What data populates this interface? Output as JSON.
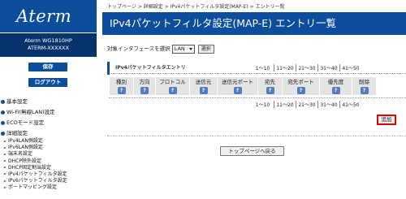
{
  "sidebar": {
    "logo": "Aterm",
    "model": "Aterm WG1810HP",
    "device": "ATERM-XXXXXX",
    "save_label": "保存",
    "logout_label": "ログアウト",
    "menu": [
      {
        "label": "基本設定"
      },
      {
        "label": "Wi-Fi(無線LAN)設定"
      },
      {
        "label": "ECOモード設定"
      },
      {
        "label": "詳細設定"
      }
    ],
    "submenu": [
      "IPv4LAN側設定",
      "IPv6LAN側設定",
      "端末名設定",
      "DHCP除外設定",
      "DHCP固定割当設定",
      "IPv4パケットフィルタ設定",
      "IPv6パケットフィルタ設定",
      "ポートマッピング設定"
    ]
  },
  "breadcrumb": "トップページ > 詳細設定 > IPv4パケットフィルタ設定(MAP-E) > エントリ一覧",
  "page_title": "IPv4パケットフィルタ設定(MAP-E) エントリ一覧",
  "interface": {
    "label": "対象インタフェースを選択",
    "selected": "LAN",
    "select_button": "選択"
  },
  "entry_title": "IPv4パケットフィルタエントリ",
  "pager": [
    "1〜10",
    "11〜20",
    "21〜30",
    "31〜40",
    "41〜50"
  ],
  "table": {
    "headers": [
      "種別",
      "方向",
      "プロトコル",
      "送信元",
      "送信元ポート",
      "宛先",
      "宛先ポート",
      "優先度",
      "削除"
    ],
    "help_label": "?"
  },
  "add_button": "追加",
  "back_button": "トップページへ戻る",
  "colors": {
    "brand_blue": "#0c4e9c",
    "dark_blue": "#07336d",
    "highlight_red": "#e00000",
    "table_header": "#e4e4e4"
  }
}
